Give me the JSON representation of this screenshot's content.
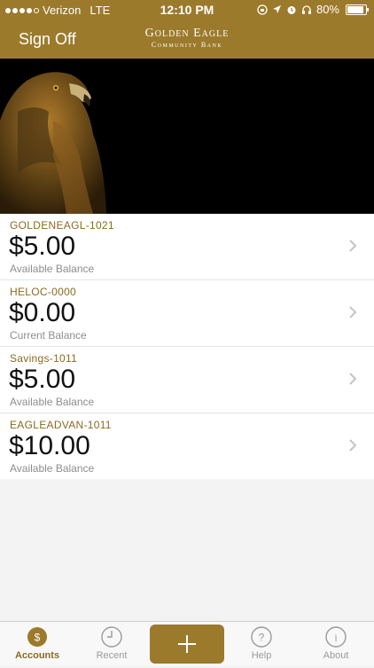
{
  "status_bar": {
    "carrier": "Verizon",
    "network": "LTE",
    "time": "12:10 PM",
    "battery": "80%"
  },
  "nav": {
    "sign_off": "Sign Off",
    "brand_line1": "Golden Eagle",
    "brand_line2": "Community Bank"
  },
  "accounts": [
    {
      "name": "GOLDENEAGL-1021",
      "amount": "$5.00",
      "label": "Available Balance"
    },
    {
      "name": "HELOC-0000",
      "amount": "$0.00",
      "label": "Current Balance"
    },
    {
      "name": "Savings-1011",
      "amount": "$5.00",
      "label": "Available Balance"
    },
    {
      "name": "EAGLEADVAN-1011",
      "amount": "$10.00",
      "label": "Available Balance"
    }
  ],
  "tabs": {
    "accounts": "Accounts",
    "accounts_icon_text": "$",
    "recent": "Recent",
    "help": "Help",
    "help_icon_text": "?",
    "about": "About",
    "about_icon_text": "i"
  },
  "colors": {
    "brand": "#9c7a2c",
    "account_name": "#8a6a22"
  }
}
